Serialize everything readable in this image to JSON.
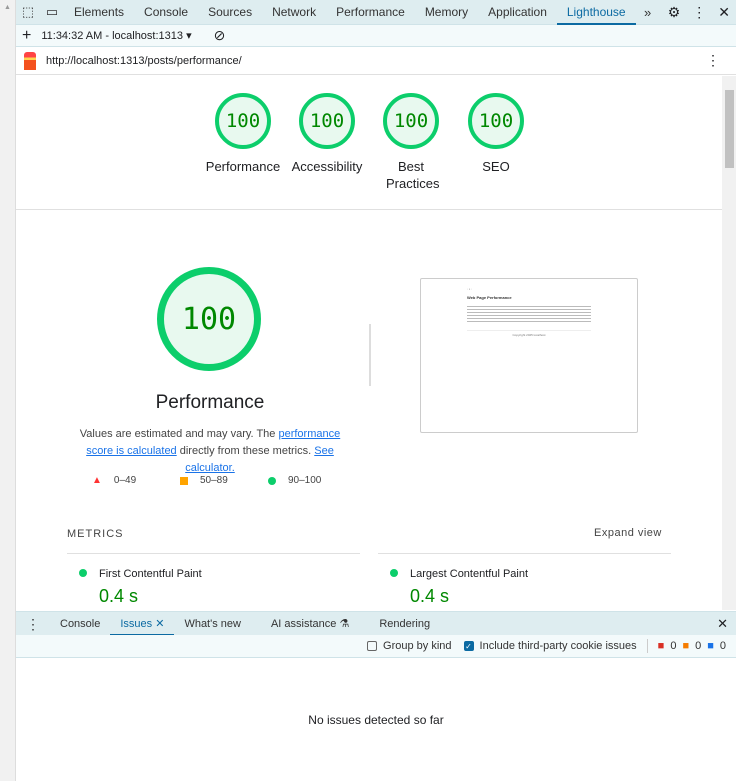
{
  "devtools": {
    "tabs": [
      "Elements",
      "Console",
      "Sources",
      "Network",
      "Performance",
      "Memory",
      "Application",
      "Lighthouse"
    ],
    "active_tab": "Lighthouse"
  },
  "toolbar": {
    "report_select": "11:34:32 AM - localhost:1313"
  },
  "url": "http://localhost:1313/posts/performance/",
  "gauges": [
    {
      "score": "100",
      "label": "Performance"
    },
    {
      "score": "100",
      "label": "Accessibility"
    },
    {
      "score": "100",
      "label": "Best Practices"
    },
    {
      "score": "100",
      "label": "SEO"
    }
  ],
  "performance": {
    "score": "100",
    "title": "Performance",
    "desc_pre": "Values are estimated and may vary. The ",
    "link1": "performance score is calculated",
    "desc_mid": " directly from these metrics. ",
    "link2": "See calculator."
  },
  "legend": [
    "0–49",
    "50–89",
    "90–100"
  ],
  "screenshot": {
    "title": "Web Page Performance",
    "footer": "Copyright 2025 localhost"
  },
  "metrics": {
    "heading": "METRICS",
    "expand": "Expand view",
    "items": [
      {
        "name": "First Contentful Paint",
        "value": "0.4 s"
      },
      {
        "name": "Largest Contentful Paint",
        "value": "0.4 s"
      }
    ]
  },
  "drawer": {
    "tabs": [
      "Console",
      "Issues",
      "What's new",
      "AI assistance",
      "Rendering"
    ],
    "group_by_kind": "Group by kind",
    "third_party": "Include third-party cookie issues",
    "counts": [
      "0",
      "0",
      "0"
    ],
    "empty": "No issues detected so far"
  },
  "colors": {
    "pass": "#0cce6b",
    "accent": "#0b6aa2"
  }
}
